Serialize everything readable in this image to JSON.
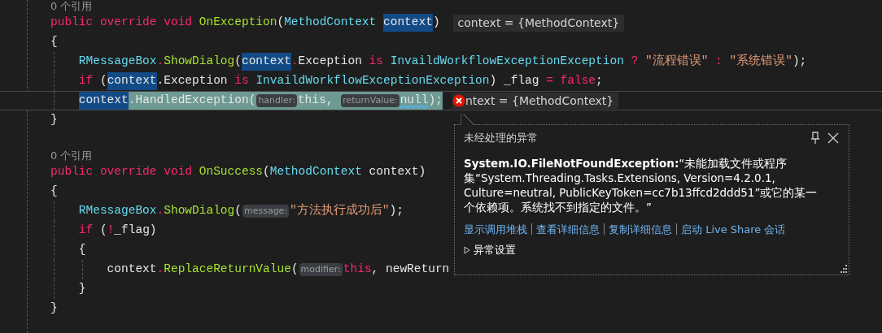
{
  "code_lines": [
    {
      "kind": "ref",
      "tokens": [
        {
          "kind": "ref",
          "text": "0 个引用"
        }
      ]
    },
    {
      "kind": "code",
      "current": false,
      "tokens": [
        {
          "kind": "keyword",
          "text": "public override void "
        },
        {
          "kind": "method",
          "text": "OnException"
        },
        {
          "kind": "plain",
          "text": "("
        },
        {
          "kind": "type",
          "text": "MethodContext "
        },
        {
          "kind": "match",
          "text": "context"
        },
        {
          "kind": "plain",
          "text": ")"
        },
        {
          "kind": "datatip",
          "text": "context = {MethodContext}"
        }
      ]
    },
    {
      "kind": "code",
      "current": false,
      "tokens": [
        {
          "kind": "plain",
          "text": "{"
        }
      ]
    },
    {
      "kind": "code",
      "current": false,
      "tokens": [
        {
          "kind": "type",
          "text": "    RMessageBox"
        },
        {
          "kind": "keyword",
          "text": "."
        },
        {
          "kind": "method",
          "text": "ShowDialog"
        },
        {
          "kind": "plain",
          "text": "("
        },
        {
          "kind": "match",
          "text": "context"
        },
        {
          "kind": "keyword",
          "text": "."
        },
        {
          "kind": "plain",
          "text": "Exception "
        },
        {
          "kind": "keyword",
          "text": "is "
        },
        {
          "kind": "type",
          "text": "InvaildWorkflowExceptionException"
        },
        {
          "kind": "keyword",
          "text": " ? "
        },
        {
          "kind": "string",
          "text": "\"流程错误\""
        },
        {
          "kind": "keyword",
          "text": " : "
        },
        {
          "kind": "string",
          "text": "\"系统错误\""
        },
        {
          "kind": "plain",
          "text": ");"
        }
      ]
    },
    {
      "kind": "code",
      "current": false,
      "tokens": [
        {
          "kind": "keyword",
          "text": "    if "
        },
        {
          "kind": "plain",
          "text": "("
        },
        {
          "kind": "match",
          "text": "context"
        },
        {
          "kind": "plain",
          "text": ".Exception "
        },
        {
          "kind": "keyword",
          "text": "is "
        },
        {
          "kind": "type",
          "text": "InvaildWorkflowExceptionException"
        },
        {
          "kind": "plain",
          "text": ") _flag "
        },
        {
          "kind": "keyword",
          "text": "= false"
        },
        {
          "kind": "plain",
          "text": ";"
        }
      ]
    },
    {
      "kind": "code",
      "current": true,
      "tokens": [
        {
          "kind": "match",
          "text": "    context"
        },
        {
          "kind": "plain",
          "text": ".HandledException("
        },
        {
          "kind": "hint",
          "text": "handler:"
        },
        {
          "kind": "plain",
          "text": "this, "
        },
        {
          "kind": "hint",
          "text": "returnValue:"
        },
        {
          "kind": "squiggle",
          "text": "null"
        },
        {
          "kind": "plain",
          "text": ");"
        },
        {
          "kind": "error_datatip",
          "text": "ntext = {MethodContext}"
        }
      ]
    },
    {
      "kind": "code",
      "current": false,
      "tokens": [
        {
          "kind": "plain",
          "text": "}"
        }
      ]
    },
    {
      "kind": "blank"
    },
    {
      "kind": "ref",
      "tokens": [
        {
          "kind": "ref",
          "text": "0 个引用"
        }
      ]
    },
    {
      "kind": "code",
      "current": false,
      "tokens": [
        {
          "kind": "keyword",
          "text": "public override void "
        },
        {
          "kind": "method",
          "text": "OnSuccess"
        },
        {
          "kind": "plain",
          "text": "("
        },
        {
          "kind": "type",
          "text": "MethodContext"
        },
        {
          "kind": "plain",
          "text": " context)"
        }
      ]
    },
    {
      "kind": "code",
      "current": false,
      "tokens": [
        {
          "kind": "plain",
          "text": "{"
        }
      ]
    },
    {
      "kind": "code",
      "current": false,
      "tokens": [
        {
          "kind": "type",
          "text": "    RMessageBox"
        },
        {
          "kind": "keyword",
          "text": "."
        },
        {
          "kind": "method",
          "text": "ShowDialog"
        },
        {
          "kind": "plain",
          "text": "("
        },
        {
          "kind": "hint",
          "text": "message:"
        },
        {
          "kind": "string",
          "text": "\"方法执行成功后\""
        },
        {
          "kind": "plain",
          "text": ");"
        }
      ]
    },
    {
      "kind": "code",
      "current": false,
      "tokens": [
        {
          "kind": "keyword",
          "text": "    if "
        },
        {
          "kind": "plain",
          "text": "("
        },
        {
          "kind": "keyword",
          "text": "!"
        },
        {
          "kind": "plain",
          "text": "_flag)"
        }
      ]
    },
    {
      "kind": "code",
      "current": false,
      "tokens": [
        {
          "kind": "plain",
          "text": "    {"
        }
      ]
    },
    {
      "kind": "code",
      "current": false,
      "tokens": [
        {
          "kind": "plain",
          "text": "        context"
        },
        {
          "kind": "keyword",
          "text": "."
        },
        {
          "kind": "method",
          "text": "ReplaceReturnValue"
        },
        {
          "kind": "plain",
          "text": "("
        },
        {
          "kind": "hint",
          "text": "modifier:"
        },
        {
          "kind": "keyword",
          "text": "this"
        },
        {
          "kind": "plain",
          "text": ", newReturn"
        }
      ]
    },
    {
      "kind": "code",
      "current": false,
      "tokens": [
        {
          "kind": "plain",
          "text": "    }"
        }
      ]
    },
    {
      "kind": "code",
      "current": false,
      "tokens": [
        {
          "kind": "plain",
          "text": "}"
        }
      ]
    }
  ],
  "exception_popup": {
    "title": "未经处理的异常",
    "message": "**System.IO.FileNotFoundException:**“未能加载文件或程序集“System.Threading.Tasks.Extensions, Version=4.2.0.1, Culture=neutral, PublicKeyToken=cc7b13ffcd2ddd51”或它的某一个依赖项。系统找不到指定的文件。”",
    "links": [
      "显示调用堆栈",
      "查看详细信息",
      "复制详细信息",
      "启动 Live Share 会话"
    ],
    "settings": {
      "label": "异常设置",
      "expanded": false
    }
  }
}
